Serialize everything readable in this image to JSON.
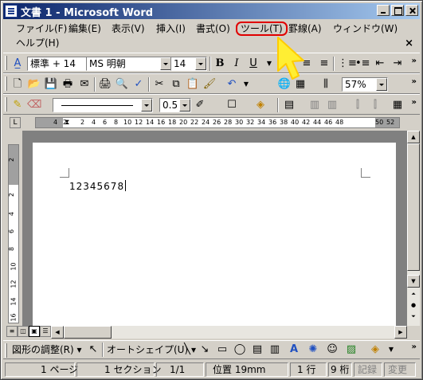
{
  "window": {
    "title": "文書 1 - Microsoft Word",
    "doc_close": "×"
  },
  "menu": {
    "items": [
      "ファイル(F)",
      "編集(E)",
      "表示(V)",
      "挿入(I)",
      "書式(O)",
      "ツール(T)",
      "罫線(A)",
      "ウィンドウ(W)",
      "ヘルプ(H)"
    ],
    "highlighted": "ツール(T)",
    "highlight_color": "#e00000"
  },
  "formatting": {
    "style": "標準 + 14",
    "font": "MS 明朝",
    "size": "14",
    "bold": "B",
    "italic": "I",
    "underline": "U"
  },
  "standard": {
    "zoom": "57%"
  },
  "drawing_toolbar": {
    "line_width": "0.5"
  },
  "ruler": {
    "numbers": [
      "4",
      "2",
      "2",
      "4",
      "6",
      "8",
      "10",
      "12",
      "14",
      "16",
      "18",
      "20",
      "22",
      "24",
      "26",
      "28",
      "30",
      "32",
      "34",
      "36",
      "38",
      "40",
      "42",
      "44",
      "46",
      "48",
      "50",
      "52"
    ]
  },
  "vruler": {
    "numbers": [
      "2",
      "2",
      "4",
      "6",
      "8",
      "10",
      "12",
      "14",
      "16"
    ]
  },
  "document": {
    "text": "12345678"
  },
  "drawbar": {
    "adjust": "図形の調整(R)",
    "autoshape": "オートシェイプ(U)"
  },
  "status": {
    "page": "1 ページ",
    "section": "1 セクション",
    "pages": "1/1",
    "position": "位置 19mm",
    "line": "1 行",
    "column": "9 桁",
    "rec": "記録",
    "trk": "変更"
  },
  "icons": [
    "app-icon",
    "new-icon",
    "open-icon",
    "save-icon",
    "print-icon",
    "preview-icon",
    "cut-icon",
    "copy-icon",
    "paste-icon",
    "undo-icon",
    "table-icon",
    "columns-icon",
    "pointer-icon"
  ]
}
